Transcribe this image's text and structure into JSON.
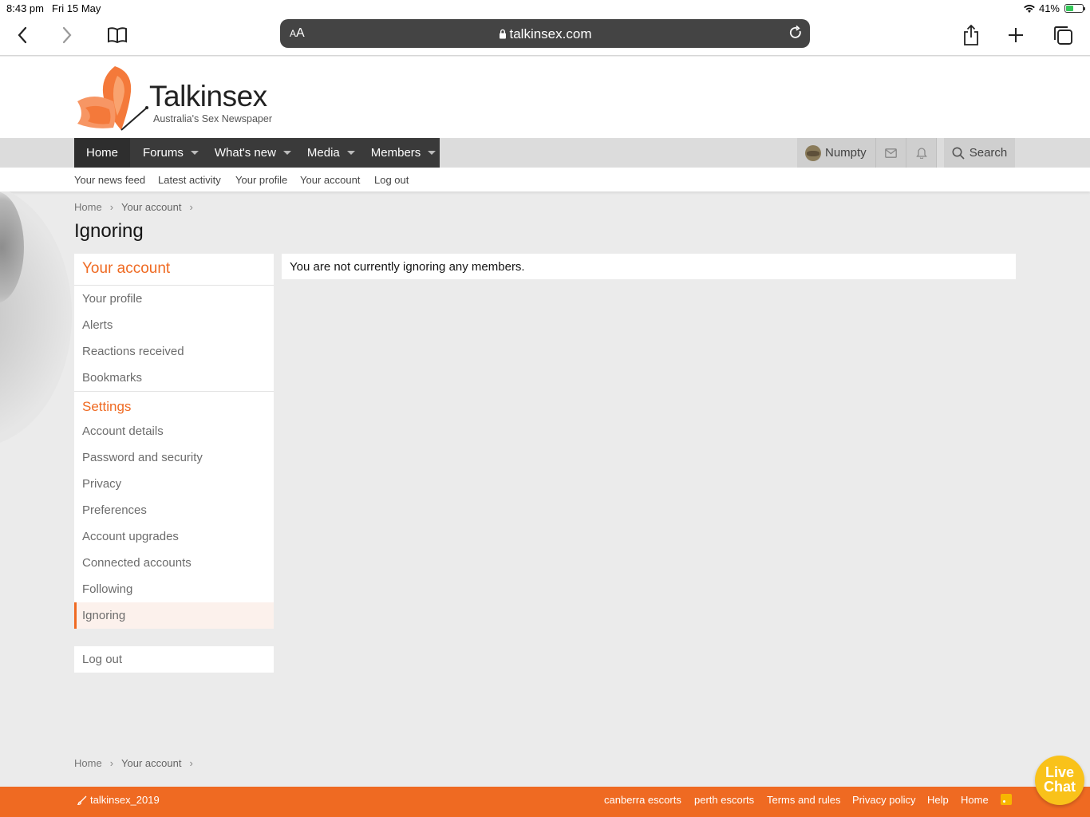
{
  "status_bar": {
    "time": "8:43 pm",
    "date": "Fri 15 May",
    "battery": "41%",
    "battery_level": 0.41
  },
  "browser": {
    "url": "talkinsex.com",
    "aa_small": "A",
    "aa_large": "A"
  },
  "site": {
    "brand": "Talkinsex",
    "tagline": "Australia's Sex Newspaper"
  },
  "nav": {
    "home": "Home",
    "forums": "Forums",
    "whats_new": "What's new",
    "media": "Media",
    "members": "Members",
    "user": "Numpty",
    "search": "Search"
  },
  "subnav": [
    "Your news feed",
    "Latest activity",
    "Your profile",
    "Your account",
    "Log out"
  ],
  "breadcrumb": {
    "home": "Home",
    "account": "Your account"
  },
  "page_title": "Ignoring",
  "sidebar": {
    "heading": "Your account",
    "account_items": [
      "Your profile",
      "Alerts",
      "Reactions received",
      "Bookmarks"
    ],
    "settings_heading": "Settings",
    "settings_items": [
      "Account details",
      "Password and security",
      "Privacy",
      "Preferences",
      "Account upgrades",
      "Connected accounts",
      "Following",
      "Ignoring"
    ],
    "logout": "Log out"
  },
  "main": {
    "message": "You are not currently ignoring any members."
  },
  "footer": {
    "style": "talkinsex_2019",
    "links": [
      "canberra escorts",
      "perth escorts",
      "Terms and rules",
      "Privacy policy",
      "Help",
      "Home"
    ]
  },
  "livechat": {
    "line1": "Live",
    "line2": "Chat"
  },
  "colors": {
    "accent": "#ef6a22",
    "nav_bg": "#3a3a3a",
    "page_bg": "#ebebeb"
  }
}
